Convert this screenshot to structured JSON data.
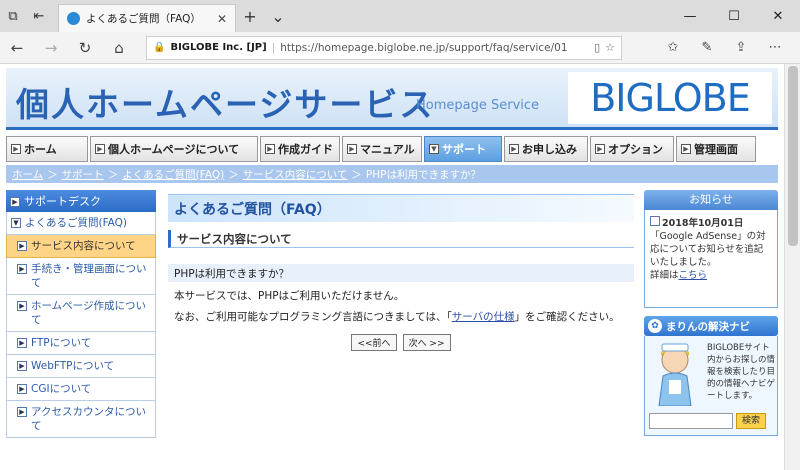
{
  "browser": {
    "tab_title": "よくあるご質問（FAQ）",
    "url_site": "BIGLOBE Inc. [JP]",
    "url": "https://homepage.biglobe.ne.jp/support/faq/service/01"
  },
  "banner": {
    "title": "個人ホームページサービス",
    "subtitle": "Homepage Service",
    "logo": "BIGLOBE"
  },
  "menu": [
    {
      "label": "ホーム"
    },
    {
      "label": "個人ホームページについて"
    },
    {
      "label": "作成ガイド"
    },
    {
      "label": "マニュアル"
    },
    {
      "label": "サポート"
    },
    {
      "label": "お申し込み"
    },
    {
      "label": "オプション"
    },
    {
      "label": "管理画面"
    }
  ],
  "breadcrumb": {
    "items": [
      "ホーム",
      "サポート",
      "よくあるご質問(FAQ)",
      "サービス内容について"
    ],
    "current": "PHPは利用できますか？"
  },
  "sidebar": {
    "header": "サポートデスク",
    "items": [
      {
        "label": "よくあるご質問(FAQ)"
      },
      {
        "label": "サービス内容について"
      },
      {
        "label": "手続き・管理画面について"
      },
      {
        "label": "ホームページ作成について"
      },
      {
        "label": "FTPについて"
      },
      {
        "label": "WebFTPについて"
      },
      {
        "label": "CGIについて"
      },
      {
        "label": "アクセスカウンタについて"
      }
    ]
  },
  "content": {
    "heading": "よくあるご質問（FAQ）",
    "section": "サービス内容について",
    "question": "PHPは利用できますか？",
    "answer1": "本サービスでは、PHPはご利用いただけません。",
    "answer2_pre": "なお、ご利用可能なプログラミング言語につきましては、「",
    "answer2_link": "サーバの仕様",
    "answer2_post": "」をご確認ください。",
    "prev": "<<前へ",
    "next": "次へ >>"
  },
  "notice": {
    "header": "お知らせ",
    "date": "2018年10月01日",
    "text": "「Google AdSense」の対応についてお知らせを追記いたしました。",
    "detail_pre": "詳細は",
    "detail_link": "こちら"
  },
  "navi": {
    "header": "まりんの解決ナビ",
    "text": "BIGLOBEサイト内からお探しの情報を検索したり目的の情報へナビゲートします。",
    "search_button": "検索"
  }
}
